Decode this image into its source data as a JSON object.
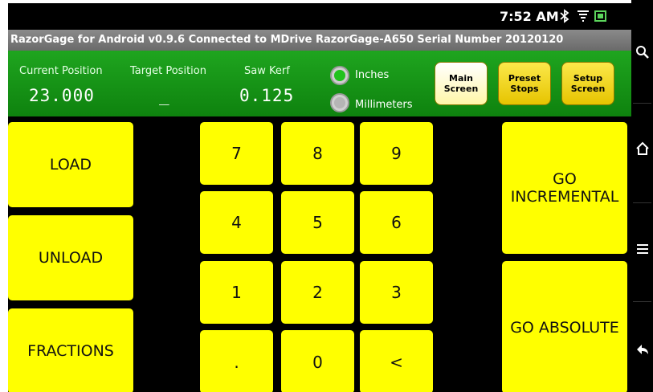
{
  "status_bar": {
    "time": "7:52 AM",
    "icons": [
      "bluetooth-icon",
      "wifi-icon",
      "battery-icon"
    ]
  },
  "title_bar": {
    "text": "RazorGage for Android v0.9.6  Connected to MDrive RazorGage-A650  Serial Number 20120120"
  },
  "header": {
    "current_position": {
      "label": "Current Position",
      "value": "23.000"
    },
    "target_position": {
      "label": "Target Position",
      "value": "_"
    },
    "saw_kerf": {
      "label": "Saw Kerf",
      "value": "0.125"
    },
    "units": {
      "inches": {
        "label": "Inches",
        "selected": true,
        "color": "#22c21e"
      },
      "millimeters": {
        "label": "Millimeters",
        "selected": false,
        "color": "#a8a8a8"
      }
    },
    "nav": {
      "main": [
        "Main",
        "Screen"
      ],
      "preset": [
        "Preset",
        "Stops"
      ],
      "setup": [
        "Setup",
        "Screen"
      ]
    }
  },
  "actions": {
    "load": "LOAD",
    "unload": "UNLOAD",
    "fractions": "FRACTIONS",
    "go_incremental": [
      "GO",
      "INCREMENTAL"
    ],
    "go_absolute": "GO ABSOLUTE"
  },
  "keypad": {
    "k7": "7",
    "k8": "8",
    "k9": "9",
    "k4": "4",
    "k5": "5",
    "k6": "6",
    "k1": "1",
    "k2": "2",
    "k3": "3",
    "dot": ".",
    "k0": "0",
    "back": "<"
  },
  "colors": {
    "header_green": "#129512",
    "key_yellow": "#ffff00",
    "background": "#000000"
  }
}
